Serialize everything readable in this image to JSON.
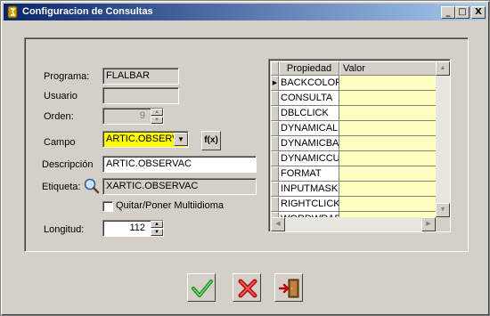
{
  "window": {
    "title": "Configuracion de Consultas",
    "min_glyph": "_",
    "max_glyph": "□",
    "close_glyph": "X"
  },
  "form": {
    "programa_label": "Programa:",
    "programa_value": "FLALBAR",
    "usuario_label": "Usuario",
    "usuario_value": "",
    "orden_label": "Orden:",
    "orden_value": "9",
    "campo_label": "Campo",
    "campo_value": "ARTIC.OBSERVAC",
    "fx_label": "f(x)",
    "descripcion_label": "Descripción",
    "descripcion_value": "ARTIC.OBSERVAC",
    "etiqueta_label": "Etiqueta:",
    "etiqueta_value": "XARTIC.OBSERVAC",
    "multiidioma_label": "Quitar/Poner Multiidioma",
    "longitud_label": "Longitud:",
    "longitud_value": "112"
  },
  "grid": {
    "columns": [
      "Propiedad",
      "Valor"
    ],
    "rows": [
      {
        "prop": "BACKCOLOR",
        "value": ""
      },
      {
        "prop": "CONSULTA",
        "value": ""
      },
      {
        "prop": "DBLCLICK",
        "value": ""
      },
      {
        "prop": "DYNAMICALIGNMENT",
        "value": ""
      },
      {
        "prop": "DYNAMICBACKCOLOR",
        "value": ""
      },
      {
        "prop": "DYNAMICCURRENTCONTROL",
        "value": ""
      },
      {
        "prop": "FORMAT",
        "value": ""
      },
      {
        "prop": "INPUTMASK",
        "value": ""
      },
      {
        "prop": "RIGHTCLICK",
        "value": ""
      },
      {
        "prop": "WORDWRAP",
        "value": ""
      }
    ],
    "current_row_marker": "▶"
  },
  "colors": {
    "campo_highlight": "#ffff00",
    "value_cell": "#ffffc0",
    "titlebar_start": "#0a246a",
    "titlebar_end": "#a6caf0"
  },
  "icons": {
    "accept": "green-check-icon",
    "cancel": "red-x-icon",
    "exit": "exit-door-icon",
    "search": "magnifier-icon",
    "app": "app-icon"
  }
}
